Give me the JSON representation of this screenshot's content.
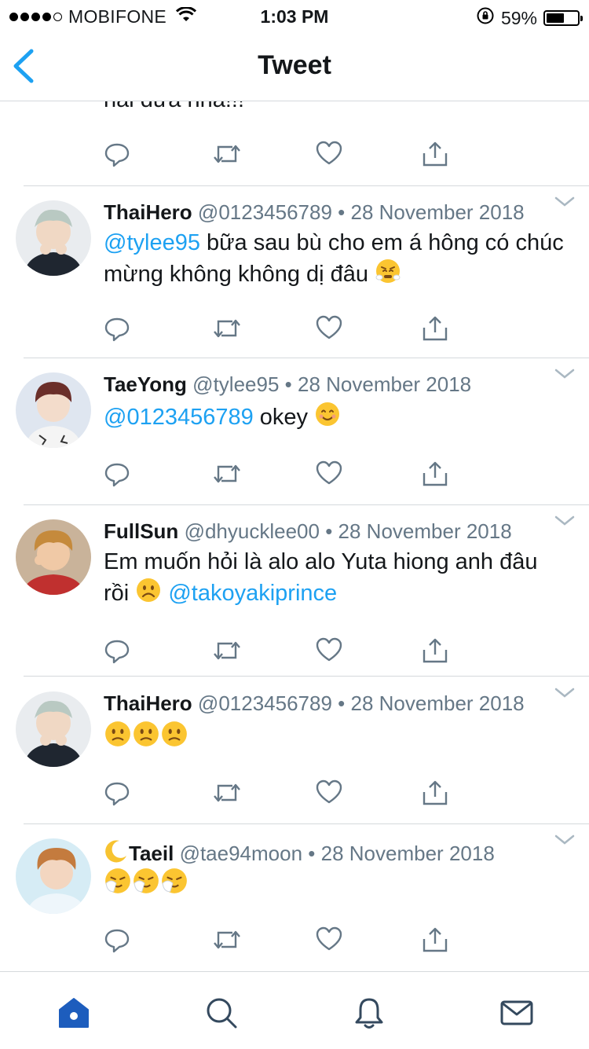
{
  "status_bar": {
    "carrier": "MOBIFONE",
    "time": "1:03 PM",
    "battery": "59%",
    "battery_level": 0.59,
    "signal_bars": 4,
    "signal_total": 5
  },
  "nav": {
    "title": "Tweet",
    "back_icon": "chevron-left-icon"
  },
  "partial_tweet": {
    "text": "hai đưa nha!!!"
  },
  "tweets": [
    {
      "name": "ThaiHero",
      "handle": "@0123456789",
      "sep": "•",
      "date": "28 November 2018",
      "mention": "@tylee95",
      "text": " bữa sau bù cho em á hông có chúc mừng không không dị đâu ",
      "emoji": "triumph-face"
    },
    {
      "name": "TaeYong",
      "handle": "@tylee95",
      "sep": "•",
      "date": "28 November 2018",
      "mention": "@0123456789",
      "text": " okey ",
      "emoji": "smiling-face"
    },
    {
      "name": "FullSun",
      "handle": "@dhyucklee00",
      "sep": "•",
      "date": "28 November 2018",
      "text": "Em muốn hỏi là alo alo Yuta hiong anh đâu rồi ",
      "emoji": "frowning-face",
      "mention_after": "@takoyakiprince"
    },
    {
      "name": "ThaiHero",
      "handle": "@0123456789",
      "sep": "•",
      "date": "28 November 2018",
      "emoji": "slightly-frowning-face",
      "emoji_count": 3
    },
    {
      "name": "Taeil",
      "name_prefix_emoji": "crescent-moon",
      "handle": "@tae94moon",
      "sep": "•",
      "date": "28 November 2018",
      "emoji": "sneezing-face",
      "emoji_count": 3
    }
  ],
  "tab_bar": {
    "items": [
      "home-icon",
      "search-icon",
      "notifications-icon",
      "messages-icon"
    ],
    "active": "home-icon"
  },
  "colors": {
    "accent": "#1da1f2",
    "secondary_text": "#657786",
    "icon": "#657786",
    "divider": "#d5d9dc",
    "tab_active": "#1d5dbd"
  }
}
